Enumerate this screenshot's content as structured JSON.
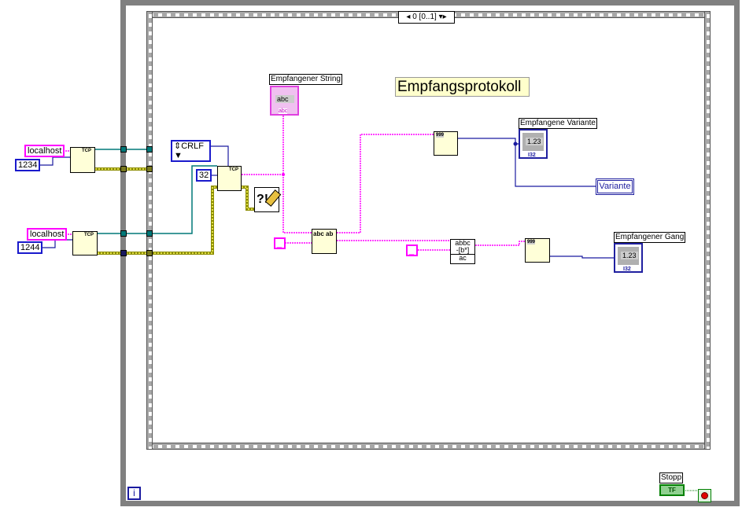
{
  "sequence": {
    "selector": "0 [0..1]"
  },
  "comment": "Empfangsprotokoll",
  "connections": [
    {
      "host": "localhost",
      "port": "1234",
      "node": "TCP"
    },
    {
      "host": "localhost",
      "port": "1244",
      "node": "TCP"
    }
  ],
  "read": {
    "mode": "CRLF",
    "bytes": "32",
    "node": "TCP"
  },
  "indicators": {
    "string": {
      "label": "Empfangener String",
      "value": "abc",
      "type": "abc"
    },
    "variante": {
      "label": "Empfangene Variante",
      "value": "1.23",
      "type": "I32"
    },
    "gang": {
      "label": "Empfangener Gang",
      "value": "1.23",
      "type": "I32"
    }
  },
  "local_variable": "Variante",
  "string_constants": [
    "_",
    "_"
  ],
  "scan_node_text": "999",
  "replace_node_text": [
    "abbc",
    "-[b*]",
    "ac"
  ],
  "loop": {
    "iteration": "i",
    "stop_label": "Stopp",
    "stop_type": "TF"
  },
  "colors": {
    "string_wire": "#ff00ff",
    "refnum_wire": "#007878",
    "error_wire": "#8c8c00",
    "number_wire": "#1a1aa0",
    "node_bg": "#ffffd8",
    "comment_bg": "#ffffcc"
  }
}
